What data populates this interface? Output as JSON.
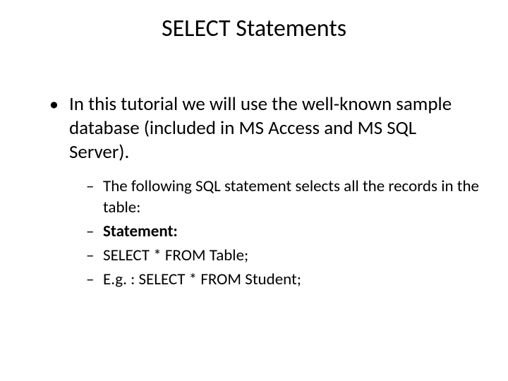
{
  "title": "SELECT Statements",
  "bullets": {
    "item1": "In this tutorial we will use the well-known sample database (included in MS Access and MS SQL Server).",
    "sub1": "The following SQL statement selects all the records in the table:",
    "sub2": "Statement:",
    "sub3": "SELECT * FROM Table;",
    "sub4": "E.g. : SELECT * FROM Student;"
  }
}
